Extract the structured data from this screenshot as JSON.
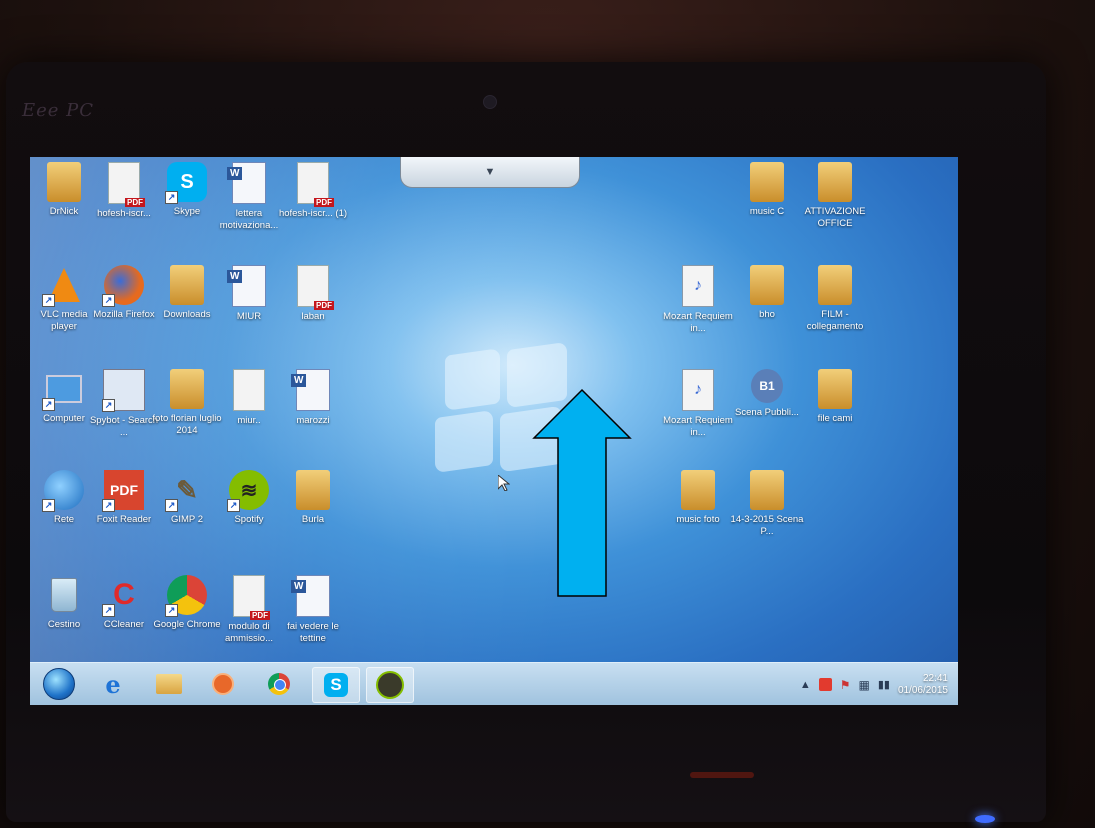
{
  "desktop": {
    "icons_left": [
      {
        "label": "DrNick",
        "type": "folder-user"
      },
      {
        "label": "hofesh-iscr...",
        "type": "pdf"
      },
      {
        "label": "Skype",
        "type": "skype"
      },
      {
        "label": "lettera motivaziona...",
        "type": "word"
      },
      {
        "label": "hofesh-iscr... (1)",
        "type": "pdf"
      },
      {
        "label": "VLC media player",
        "type": "vlc"
      },
      {
        "label": "Mozilla Firefox",
        "type": "firefox"
      },
      {
        "label": "Downloads",
        "type": "folder"
      },
      {
        "label": "MIUR",
        "type": "word"
      },
      {
        "label": "laban",
        "type": "pdf"
      },
      {
        "label": "Computer",
        "type": "computer"
      },
      {
        "label": "Spybot - Search ...",
        "type": "spybot"
      },
      {
        "label": "foto florian luglio 2014",
        "type": "folder"
      },
      {
        "label": "miur..",
        "type": "doc"
      },
      {
        "label": "marozzi",
        "type": "word"
      },
      {
        "label": "Rete",
        "type": "network"
      },
      {
        "label": "Foxit Reader",
        "type": "foxit"
      },
      {
        "label": "GIMP 2",
        "type": "gimp"
      },
      {
        "label": "Spotify",
        "type": "spotify"
      },
      {
        "label": "Burla",
        "type": "folder"
      },
      {
        "label": "Cestino",
        "type": "recycle"
      },
      {
        "label": "CCleaner",
        "type": "ccleaner"
      },
      {
        "label": "Google Chrome",
        "type": "chrome"
      },
      {
        "label": "modulo di ammissio...",
        "type": "pdf"
      },
      {
        "label": "fai vedere le tettine",
        "type": "word"
      }
    ],
    "icons_right": [
      {
        "label": "music C",
        "type": "folder"
      },
      {
        "label": "ATTIVAZIONE OFFICE",
        "type": "folder"
      },
      {
        "label": "Mozart Requiem in...",
        "type": "mp3"
      },
      {
        "label": "bho",
        "type": "folder"
      },
      {
        "label": "FILM - collegamento",
        "type": "folder"
      },
      {
        "label": "Mozart Requiem in...",
        "type": "mp3"
      },
      {
        "label": "Scena Pubbli...",
        "type": "zip"
      },
      {
        "label": "file cami",
        "type": "folder"
      },
      {
        "label": "music foto",
        "type": "folder"
      },
      {
        "label": "14-3-2015 Scena P...",
        "type": "folder"
      }
    ]
  },
  "taskbar": {
    "pinned": [
      "start",
      "internet-explorer",
      "file-explorer",
      "media-player",
      "chrome",
      "skype",
      "spotify"
    ],
    "clock_time": "22:41",
    "clock_date": "01/06/2015"
  },
  "overlay": {
    "arrow_color": "#00B0F0"
  }
}
